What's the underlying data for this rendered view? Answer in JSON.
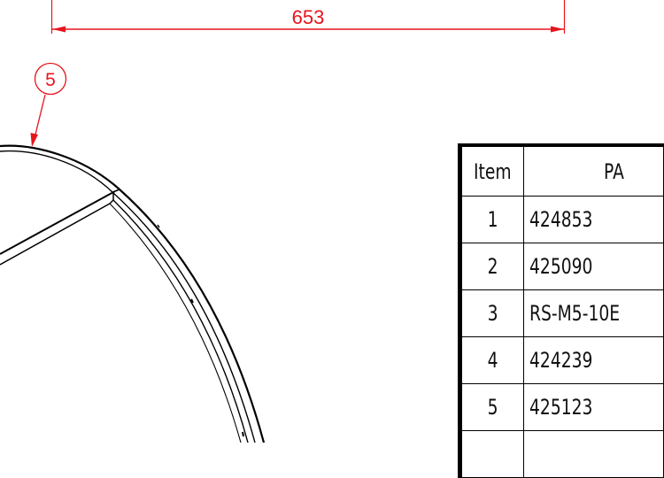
{
  "colors": {
    "annotation": "#e8141c",
    "geometry": "#000000",
    "background": "#ffffff"
  },
  "dimension": {
    "value": "653"
  },
  "balloon": {
    "label": "5"
  },
  "bom_table": {
    "headers": {
      "item": "Item",
      "part": "PA"
    },
    "rows": [
      {
        "item": "1",
        "part": "424853"
      },
      {
        "item": "2",
        "part": "425090"
      },
      {
        "item": "3",
        "part": "RS-M5-10E"
      },
      {
        "item": "4",
        "part": "424239"
      },
      {
        "item": "5",
        "part": "425123"
      }
    ]
  }
}
